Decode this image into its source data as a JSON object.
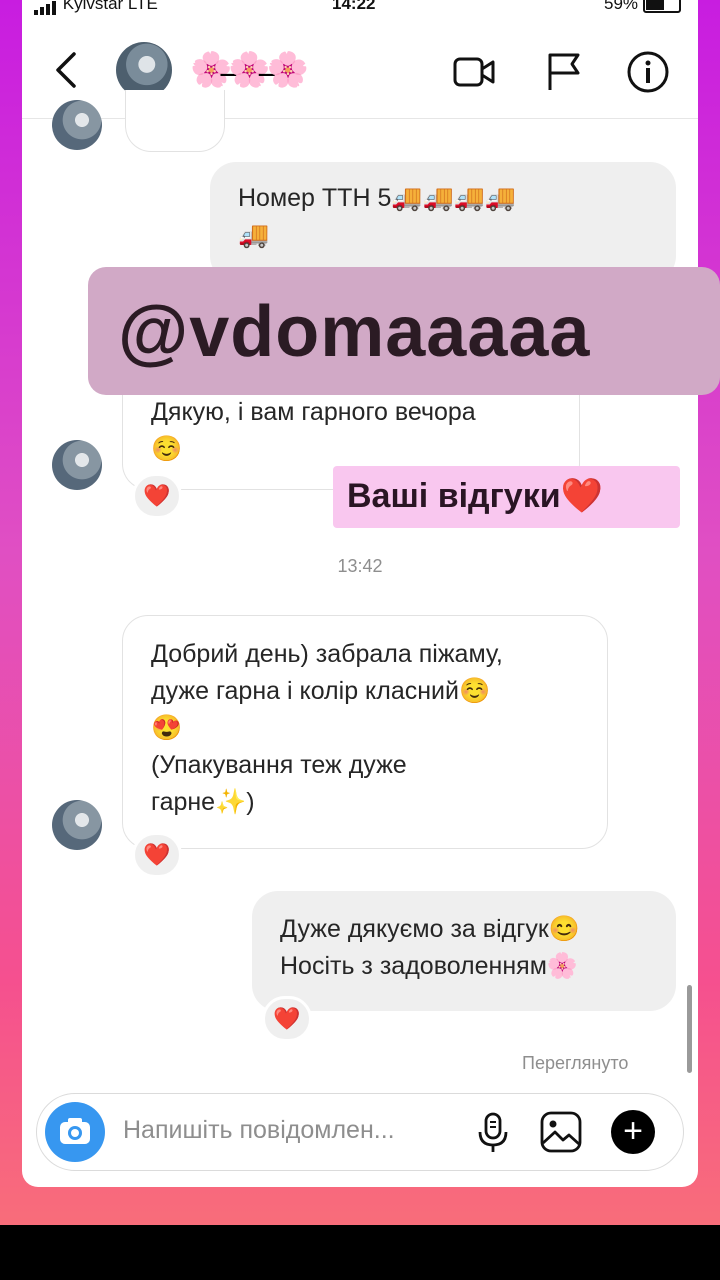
{
  "status_bar": {
    "carrier": "Kyivstar  LTE",
    "time": "14:22",
    "battery": "59%"
  },
  "header": {
    "username": "🌸̶🌸̶🌸",
    "icons": [
      "back-chevron-icon",
      "video-camera-icon",
      "flag-icon",
      "info-icon"
    ]
  },
  "messages": {
    "partial_top": "",
    "ttn": "Номер ТТН 5🚚🚚🚚🚚\n🚚",
    "thanks": "Дякую, і вам гарного вечора\n☺️",
    "thanks_reaction": "❤️",
    "timestamp": "13:42",
    "review": "Добрий день) забрала піжаму,\nдуже гарна і колір класний☺️\n😍\n(Упакування теж дуже\nгарне✨)",
    "review_reaction": "❤️",
    "reply": "Дуже дякуємо за відгук😊\nНосіть з задоволенням🌸",
    "reply_reaction": "❤️",
    "seen": "Переглянуто"
  },
  "composer": {
    "placeholder": "Напишіть повідомлен..."
  },
  "overlays": {
    "handle": "@vdomaaaaa",
    "reviews": "Ваші відгуки❤️"
  },
  "colors": {
    "accent": "#3797f0",
    "overlay_handle": "#d1a9c6",
    "overlay_reviews": "#f9c7ef"
  }
}
